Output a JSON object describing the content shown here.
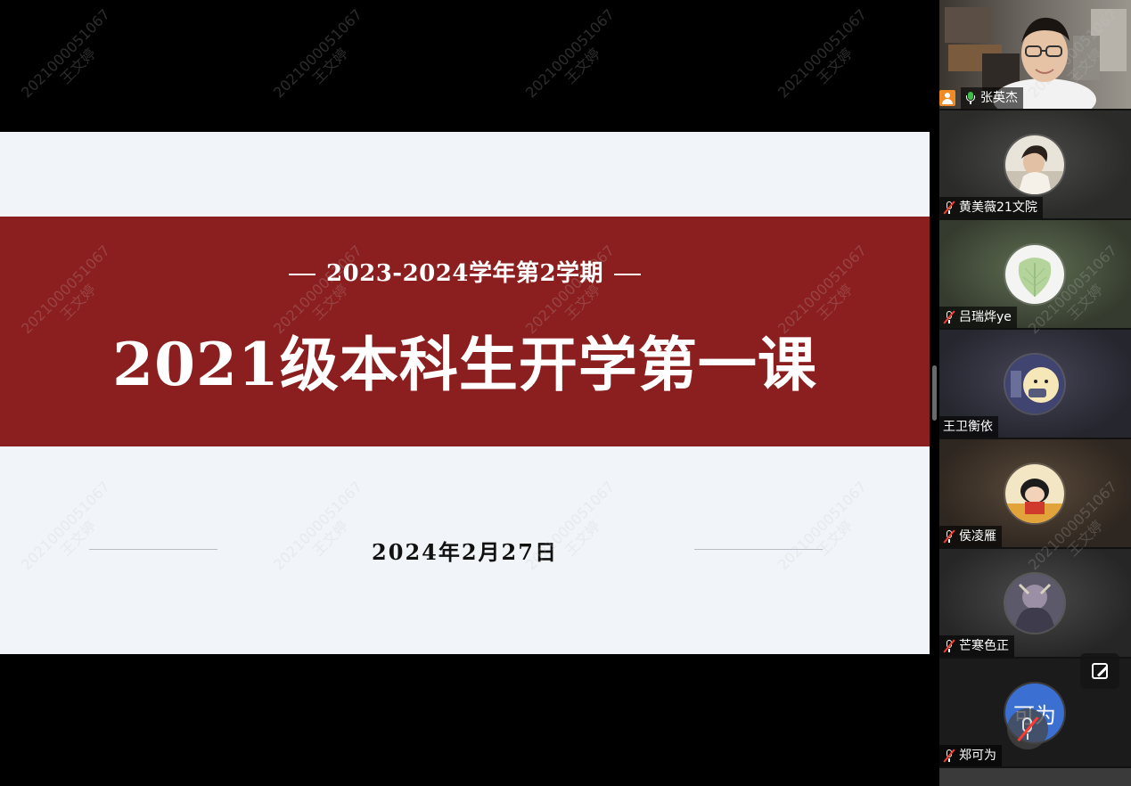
{
  "slide": {
    "subtitle": "2023-2024学年第2学期",
    "title": "2021级本科生开学第一课",
    "date": "2024年2月27日",
    "band_color": "#8b1e1e",
    "background_color": "#f1f4f8"
  },
  "watermark": {
    "line1": "2021000051067",
    "line2": "王文婷"
  },
  "participants": [
    {
      "name": "张英杰",
      "mic": "on",
      "video": true,
      "active_speaker": true,
      "badge": "person-icon"
    },
    {
      "name": "黄美薇21文院",
      "mic": "muted",
      "video": false
    },
    {
      "name": "吕瑞烨ye",
      "mic": "muted",
      "video": false
    },
    {
      "name": "王卫衡依",
      "mic": "none",
      "video": false
    },
    {
      "name": "侯凌雁",
      "mic": "muted",
      "video": false
    },
    {
      "name": "芒寒色正",
      "mic": "muted",
      "video": false
    },
    {
      "name": "郑可为",
      "mic": "muted",
      "video": false,
      "avatar_text": "可为"
    }
  ],
  "icons": {
    "edit": "edit-icon",
    "mic_muted": "mic-muted-icon",
    "mic_on": "mic-on-icon",
    "person": "person-icon"
  },
  "colors": {
    "active_speaker_border": "#3dc14a",
    "mic_muted_slash": "#ff3b30",
    "mic_on": "#3dc14a",
    "badge_orange": "#f08a24"
  }
}
